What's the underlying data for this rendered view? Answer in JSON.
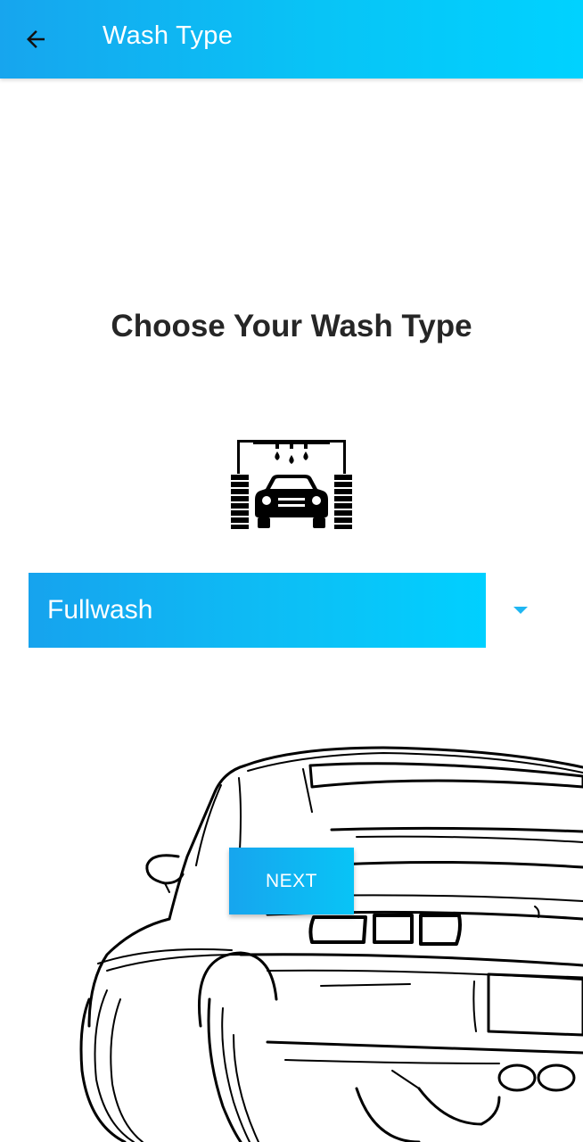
{
  "appbar": {
    "title": "Wash Type",
    "back_icon": "arrow-left-icon",
    "gradient": [
      "#17a5ee",
      "#00d2ff"
    ]
  },
  "main": {
    "heading": "Choose Your Wash Type",
    "illustration_icon": "car-wash-icon",
    "wash_type_select": {
      "selected": "Fullwash",
      "arrow_icon": "caret-down-icon"
    },
    "next_button": {
      "label": "NEXT"
    },
    "background_art": "car-rear-sketch"
  },
  "colors": {
    "accent": "#08c4f6",
    "heading_text": "#262626",
    "background": "#ffffff"
  }
}
